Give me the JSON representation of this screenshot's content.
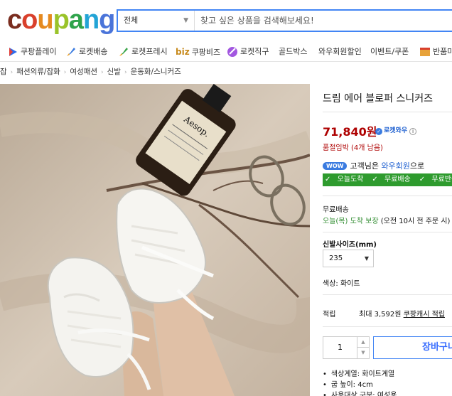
{
  "header": {
    "logo_letters": [
      {
        "ch": "c",
        "color": "#7a2d1f"
      },
      {
        "ch": "o",
        "color": "#d9402c"
      },
      {
        "ch": "u",
        "color": "#e58a1f"
      },
      {
        "ch": "p",
        "color": "#9ac32a"
      },
      {
        "ch": "a",
        "color": "#2fa34b"
      },
      {
        "ch": "n",
        "color": "#23a4d6"
      },
      {
        "ch": "g",
        "color": "#4a74d9"
      }
    ],
    "search_category": "전체",
    "search_placeholder": "찾고 싶은 상품을 검색해보세요!"
  },
  "nav": {
    "items": [
      {
        "label": "쿠팡플레이",
        "icon": "play-icon",
        "color": "#2c6bed"
      },
      {
        "label": "로켓배송",
        "icon": "rocket-icon",
        "color": "#3a7be0"
      },
      {
        "label": "로켓프레시",
        "icon": "rocket-fresh-icon",
        "color": "#3aa54a"
      },
      {
        "label": "쿠팡비즈",
        "icon": "biz-icon",
        "color": "#c78a1c"
      },
      {
        "label": "로켓직구",
        "icon": "rocket-global-icon",
        "color": "#a257e0"
      },
      {
        "label": "골드박스",
        "icon": "",
        "color": ""
      },
      {
        "label": "와우회원할인",
        "icon": "",
        "color": ""
      },
      {
        "label": "이벤트/쿠폰",
        "icon": "",
        "color": ""
      },
      {
        "label": "반품마",
        "icon": "return-market-icon",
        "color": "#e7a23a"
      }
    ],
    "biz_prefix": "biz"
  },
  "breadcrumb": [
    "잡",
    "패션의류/잡화",
    "여성패션",
    "신발",
    "운동화/스니커즈"
  ],
  "product": {
    "title": "드림 에어 블로퍼 스니커즈",
    "price": "71,840원",
    "rocket_wow": "로켓와우",
    "stock": "품절임박 (4개 남음)",
    "wow_badge": "WOW",
    "wow_text": "고객님은",
    "wow_link": "와우회원",
    "wow_suffix": "으로",
    "benefits": [
      "오늘도착",
      "무료배송",
      "무료반품"
    ],
    "shipping_label": "무료배송",
    "shipping_green": "오늘(목) 도착 보장",
    "shipping_note": "(오전 10시 전 주문 시)",
    "size_label": "신발사이즈(mm)",
    "size_value": "235",
    "color_line": "색상: 화이트",
    "points_label": "적립",
    "points_text": "최대 3,592원",
    "points_link": "쿠팡캐시 적립",
    "quantity": "1",
    "buy_label": "장바구니",
    "attributes": [
      "색상계열: 화이트계열",
      "굽 높이: 4cm",
      "사용대상 구분: 여성용"
    ]
  },
  "photo": {
    "bottle_label": "Aesop."
  }
}
